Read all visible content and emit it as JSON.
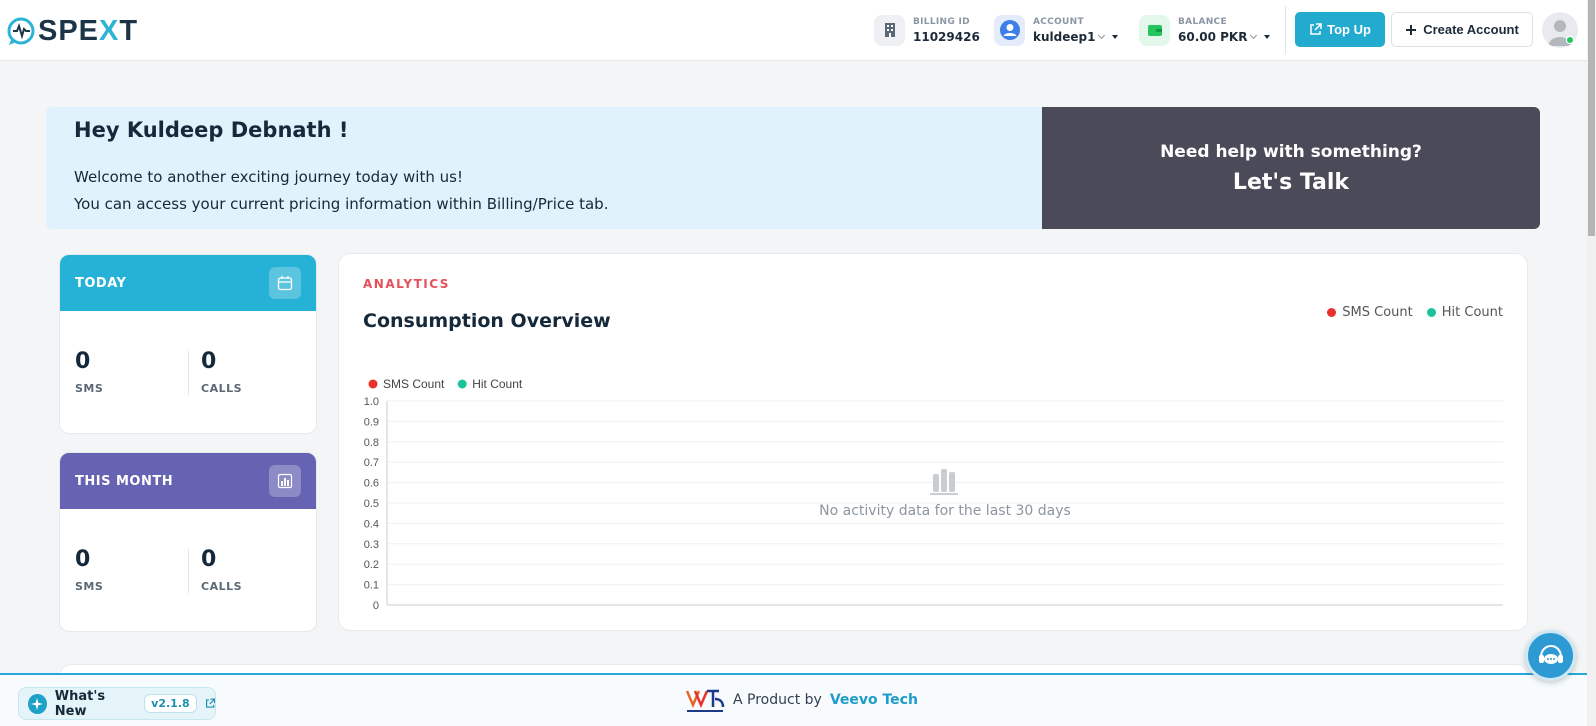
{
  "header": {
    "logo_prefix": "SPE",
    "logo_x": "X",
    "logo_suffix": "T",
    "billing": {
      "label": "BILLING ID",
      "value": "11029426"
    },
    "account": {
      "label": "ACCOUNT",
      "value": "kuldeep1"
    },
    "balance": {
      "label": "BALANCE",
      "value": "60.00 PKR"
    },
    "topup_label": "Top Up",
    "create_account_label": "Create Account"
  },
  "welcome": {
    "greeting": "Hey Kuldeep Debnath !",
    "line1": "Welcome to another exciting journey today with us!",
    "line2": "You can access your current pricing information within Billing/Price tab."
  },
  "help": {
    "question": "Need help with something?",
    "cta": "Let's Talk"
  },
  "today": {
    "title": "TODAY",
    "sms_value": "0",
    "sms_label": "SMS",
    "calls_value": "0",
    "calls_label": "CALLS"
  },
  "month": {
    "title": "THIS MONTH",
    "sms_value": "0",
    "sms_label": "SMS",
    "calls_value": "0",
    "calls_label": "CALLS"
  },
  "analytics": {
    "tag": "ANALYTICS",
    "title": "Consumption Overview",
    "legend": [
      {
        "name": "SMS Count",
        "color": "#e8312a"
      },
      {
        "name": "Hit Count",
        "color": "#1bc39b"
      }
    ],
    "empty_message": "No activity data for the last 30 days"
  },
  "chart_data": {
    "type": "line",
    "title": "",
    "xlabel": "",
    "ylabel": "",
    "ylim": [
      0,
      1
    ],
    "y_ticks": [
      "0",
      "0.1",
      "0.2",
      "0.3",
      "0.4",
      "0.5",
      "0.6",
      "0.7",
      "0.8",
      "0.9",
      "1.0"
    ],
    "series": [
      {
        "name": "SMS Count",
        "color": "#e8312a",
        "values": []
      },
      {
        "name": "Hit Count",
        "color": "#1bc39b",
        "values": []
      }
    ],
    "legend_position": "top-left",
    "grid": true
  },
  "footer": {
    "whats_new_label": "What's New",
    "version": "v2.1.8",
    "product_prefix": "A Product by",
    "product_company": "Veevo Tech"
  },
  "colors": {
    "accent": "#22aacf",
    "today_header": "#25b2d6",
    "month_header": "#6664b2",
    "analytics_tag": "#e6505a",
    "help_bg": "#4a4a58"
  }
}
